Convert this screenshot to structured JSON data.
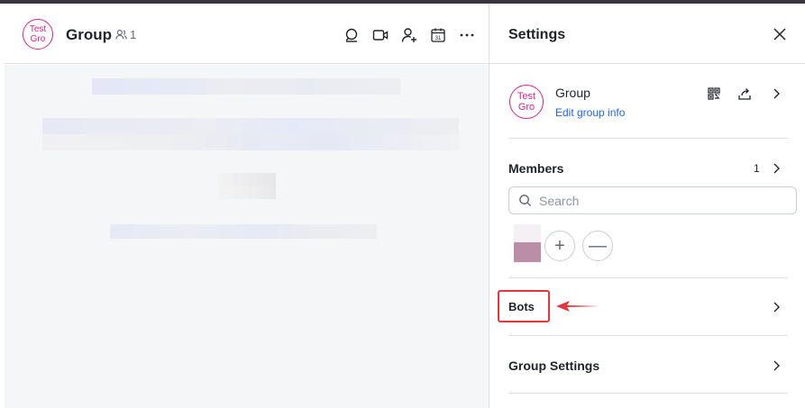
{
  "chat": {
    "avatar_line1": "Test",
    "avatar_line2": "Gro",
    "title": "Group",
    "member_count": "1",
    "icons": [
      "search-chat-icon",
      "video-call-icon",
      "add-member-icon",
      "calendar-icon",
      "more-icon"
    ],
    "calendar_day": "31"
  },
  "settings": {
    "title": "Settings",
    "group": {
      "avatar_line1": "Test",
      "avatar_line2": "Gro",
      "name": "Group",
      "edit_label": "Edit group info"
    },
    "members": {
      "title": "Members",
      "count": "1",
      "search_placeholder": "Search",
      "add_symbol": "+",
      "remove_symbol": "—"
    },
    "bots": {
      "title": "Bots"
    },
    "group_settings": {
      "title": "Group Settings"
    }
  },
  "colors": {
    "accent_pink": "#e1238a",
    "link_blue": "#1f64f5",
    "highlight_red": "#e8333a",
    "divider": "#dee0e3"
  }
}
